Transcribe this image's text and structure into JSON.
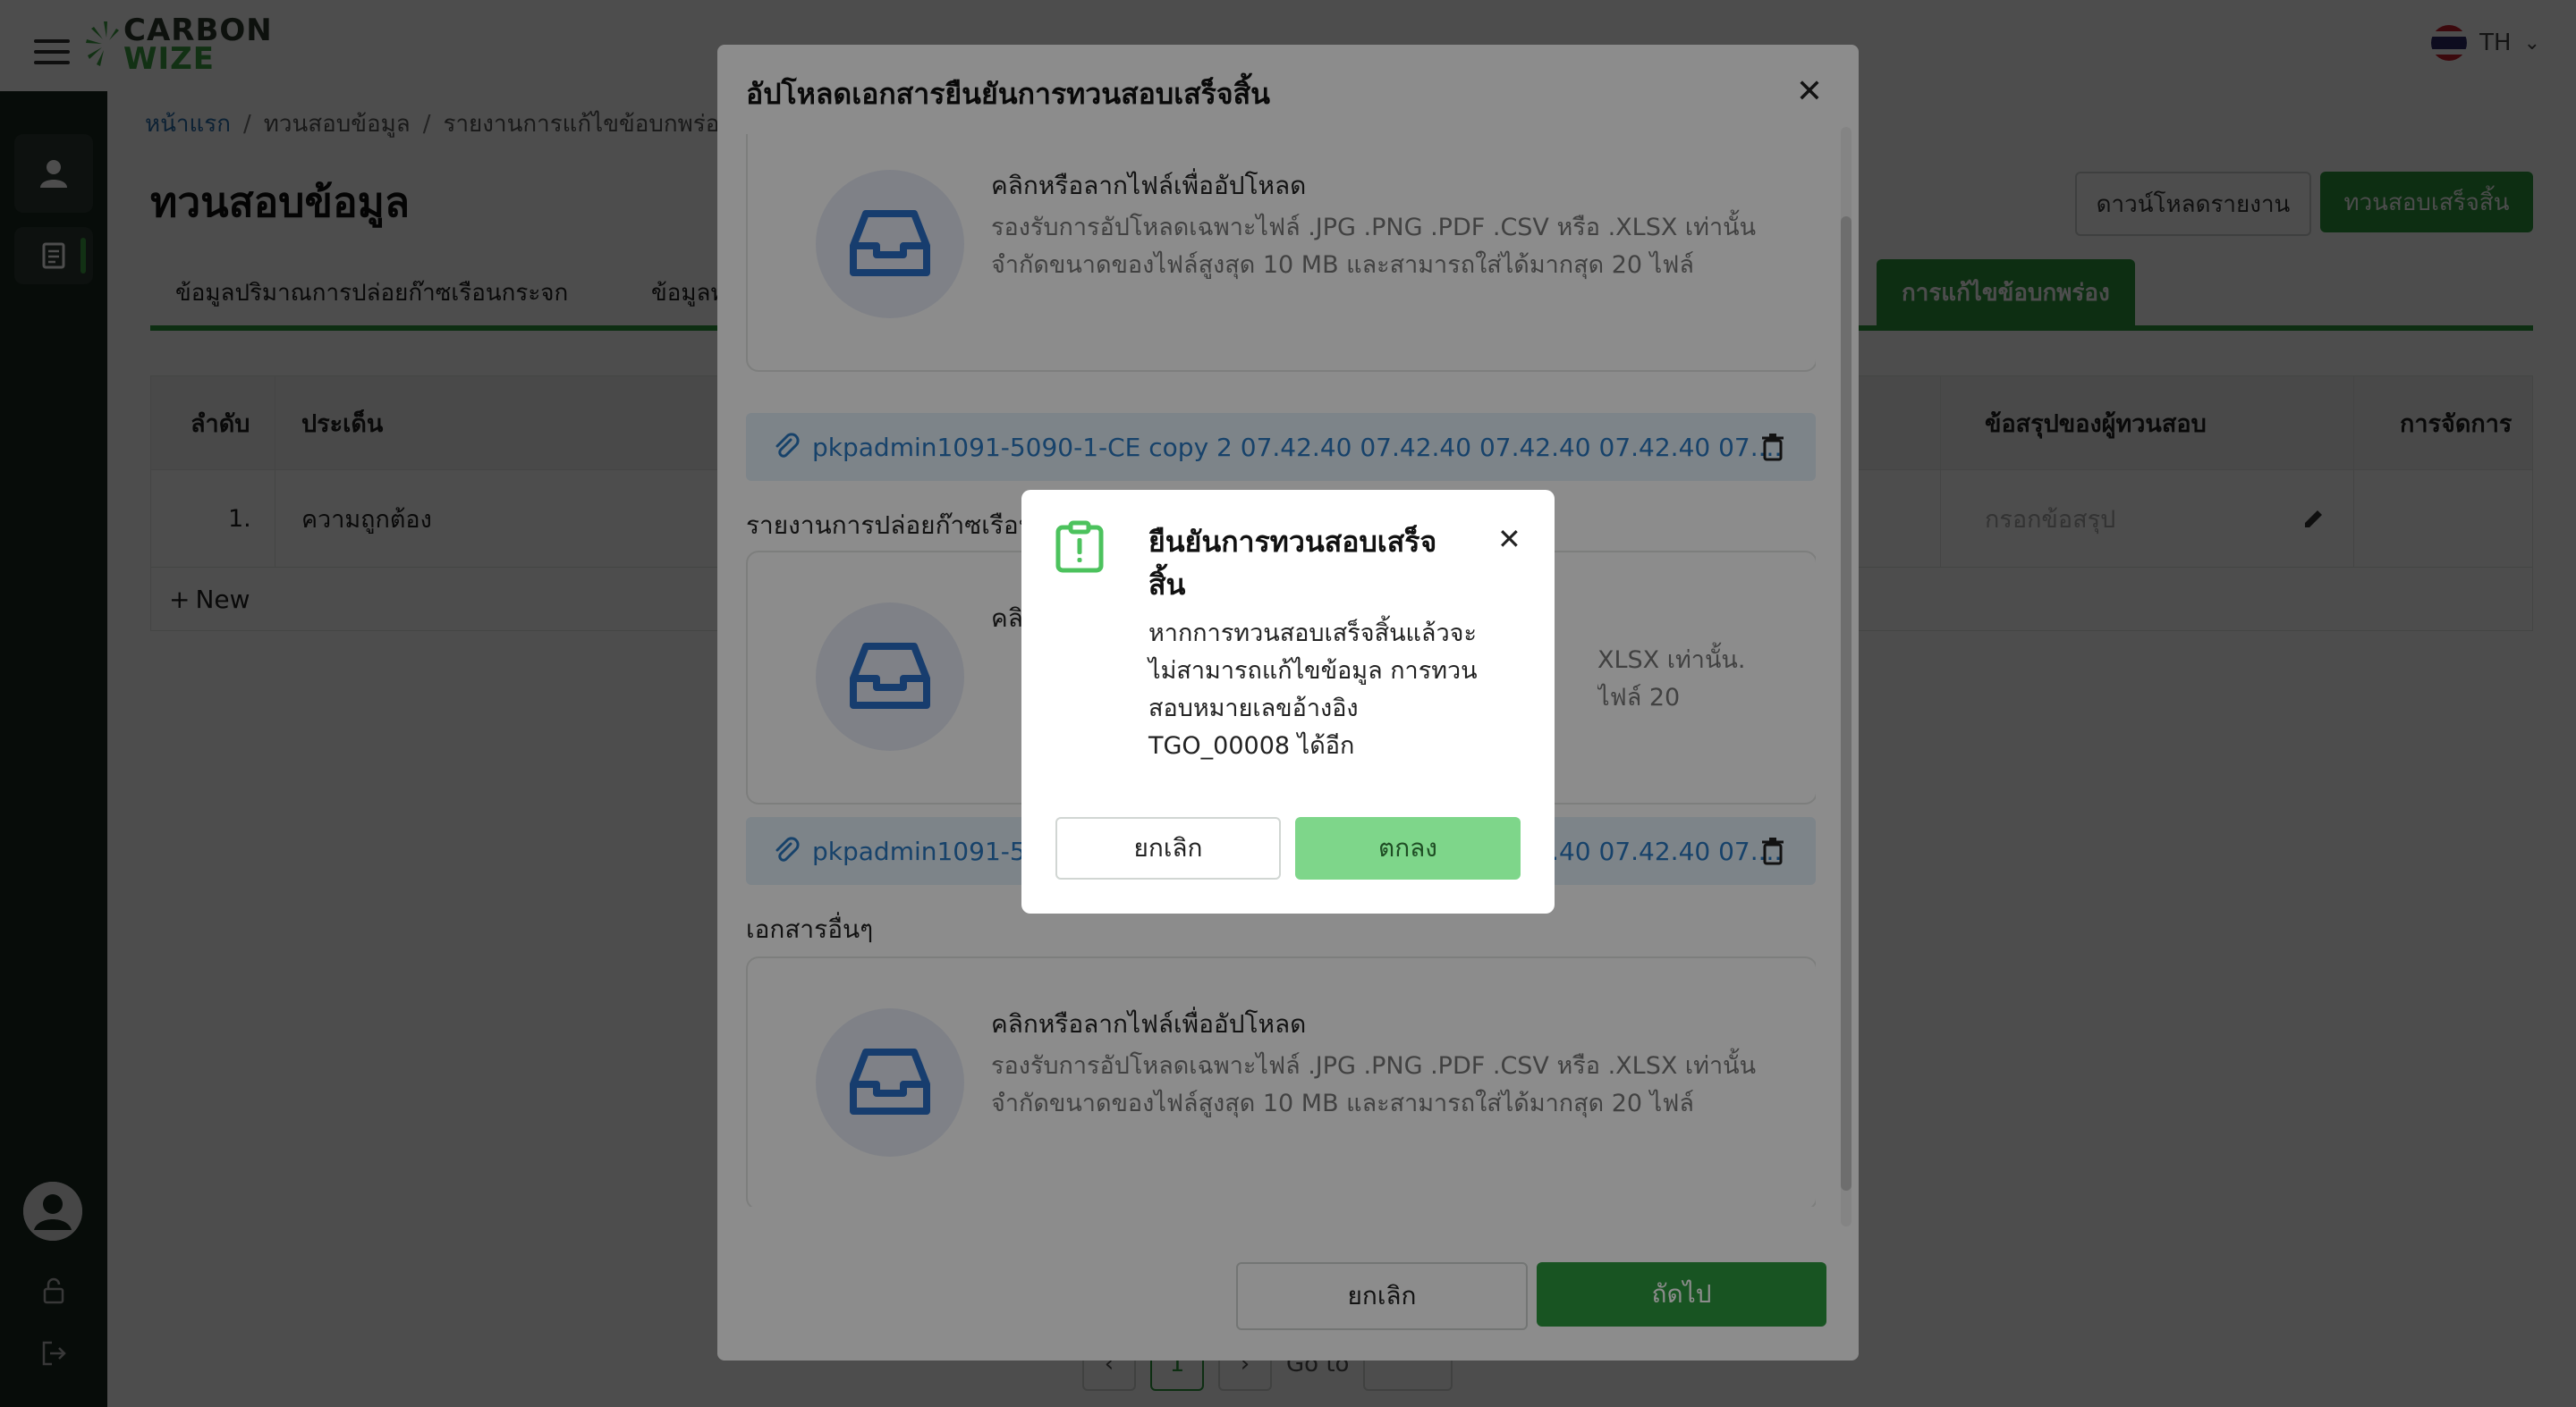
{
  "app": {
    "brand_line1": "CARBON",
    "brand_line2": "WIZE",
    "language": "TH"
  },
  "breadcrumb": [
    "หน้าแรก",
    "ทวนสอบข้อมูล",
    "รายงานการแก้ไขข้อบกพร่อ"
  ],
  "page": {
    "title": "ทวนสอบข้อมูล",
    "download_label": "ดาวน์โหลดรายงาน",
    "finish_label": "ทวนสอบเสร็จสิ้น"
  },
  "tabs": [
    "ข้อมูลปริมาณการปล่อยก๊าซเรือนกระจก",
    "ข้อมูลทั่วไป",
    "การแก้ไขข้อบกพร่อง"
  ],
  "table": {
    "headers": {
      "no": "ลำดับ",
      "issue": "ประเด็น",
      "summary": "ข้อสรุปของผู้ทวนสอบ",
      "actions": "การจัดการ"
    },
    "rows": [
      {
        "no": "1.",
        "issue": "ความถูกต้อง",
        "summary_placeholder": "กรอกข้อสรุป"
      }
    ],
    "new_label": "New"
  },
  "pagination": {
    "current": "1",
    "goto_label": "Go to"
  },
  "upload_modal": {
    "title": "อัปโหลดเอกสารยืนยันการทวนสอบเสร็จสิ้น",
    "dropzone_title": "คลิกหรือลากไฟล์เพื่ออัปโหลด",
    "dropzone_title_partial": "คลิ",
    "dropzone_line1": "รองรับการอัปโหลดเฉพาะไฟล์ .JPG .PNG .PDF .CSV หรือ .XLSX เท่านั้น",
    "dropzone_line2": "จำกัดขนาดของไฟล์สูงสุด 10 MB และสามารถใส่ได้มากสุด 20 ไฟล์",
    "file1_name": "pkpadmin1091-5090-1-CE copy 2 07.42.40 07.42.40 07.42.40 07.42.40 07....",
    "file2_name": "pkpadmin1091-5090-1-CE copy 2 07.42.40 07.42.40 07.42.40 07.42.40 07....",
    "section_report": "รายงานการปล่อยก๊าซเรือนกระจก",
    "required_mark": "*",
    "section_other": "เอกสารอื่นๆ",
    "cancel_label": "ยกเลิก",
    "next_label": "ถัดไป"
  },
  "confirm_dialog": {
    "title": "ยืนยันการทวนสอบเสร็จสิ้น",
    "message_lines": [
      "หากการทวนสอบเสร็จสิ้นแล้วจะ",
      "ไม่สามารถแก้ไขข้อมูล การทวน",
      "สอบหมายเลขอ้างอิง",
      "TGO_00008 ได้อีก"
    ],
    "cancel_label": "ยกเลิก",
    "ok_label": "ตกลง"
  },
  "colors": {
    "primary_green": "#2d9a3f",
    "ok_green": "#7ed68a",
    "sidebar": "#1b2a22",
    "link_blue": "#2a79c2"
  }
}
